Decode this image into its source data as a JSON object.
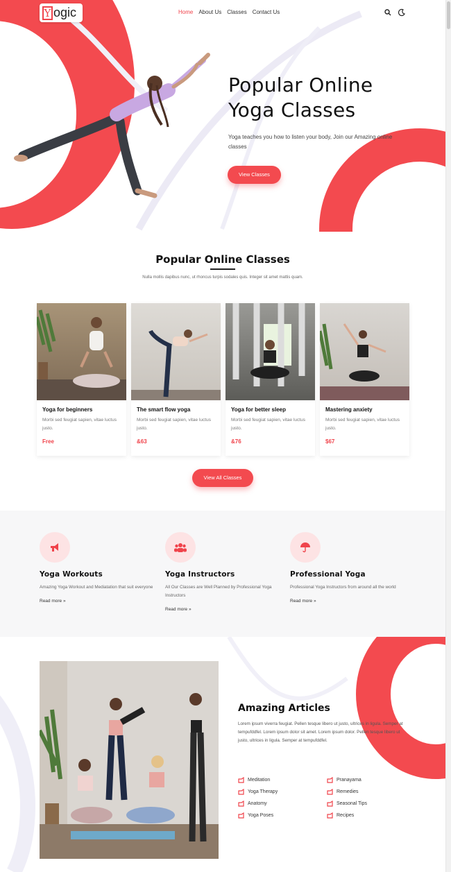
{
  "brand": {
    "logo_mark": "Y",
    "logo_text": "ogic",
    "accent": "#f34a4f"
  },
  "nav": {
    "items": [
      {
        "label": "Home",
        "active": true
      },
      {
        "label": "About Us",
        "active": false
      },
      {
        "label": "Classes",
        "active": false
      },
      {
        "label": "Contact Us",
        "active": false
      }
    ],
    "icons": [
      "search-icon",
      "moon-icon"
    ]
  },
  "hero": {
    "title_line1": "Popular Online",
    "title_line2": "Yoga Classes",
    "subtitle": "Yoga teaches you how to listen your body, Join our Amazing online classes",
    "button": "View Classes"
  },
  "classes": {
    "title": "Popular Online Classes",
    "description": "Nulla mollis dapibus nunc, ut rhoncus turpis sodales quis. Integer sit amet mattis quam.",
    "cards": [
      {
        "title": "Yoga for beginners",
        "desc": "Morbi sed feugiat sapien, vitae luctus justo.",
        "price": "Free"
      },
      {
        "title": "The smart flow yoga",
        "desc": "Morbi sed feugiat sapien, vitae luctus justo.",
        "price": "&63"
      },
      {
        "title": "Yoga for better sleep",
        "desc": "Morbi sed feugiat sapien, vitae luctus justo.",
        "price": "&76"
      },
      {
        "title": "Mastering anxiety",
        "desc": "Morbi sed feugiat sapien, vitae luctus justo.",
        "price": "$67"
      }
    ],
    "button": "View All Classes"
  },
  "features": [
    {
      "icon": "megaphone-icon",
      "title": "Yoga Workouts",
      "desc": "Amazing Yoga Workout and Mediatation that suit everyone",
      "more": "Read more »"
    },
    {
      "icon": "group-icon",
      "title": "Yoga Instructors",
      "desc": "All Our Classes are Well Planned by Professional Yoga Instructors",
      "more": "Read more »"
    },
    {
      "icon": "umbrella-icon",
      "title": "Professional Yoga",
      "desc": "Professional Yoga Instructors from around all the world",
      "more": "Read more »"
    }
  ],
  "articles": {
    "title": "Amazing Articles",
    "desc": "Lorem ipsum viverra feugiat. Pellen tesque libero ut justo, ultrices in ligula. Semper at tempufddfel. Lorem ipsum dolor sit amet. Lorem ipsum dolor. Pellen tesque libero ut justo, ultrices in ligula. Semper at tempufddfel.",
    "left_list": [
      "Meditation",
      "Yoga Therapy",
      "Anatomy",
      "Yoga Poses"
    ],
    "right_list": [
      "Pranayama",
      "Remedies",
      "Seasonal Tips",
      "Recipes"
    ]
  }
}
